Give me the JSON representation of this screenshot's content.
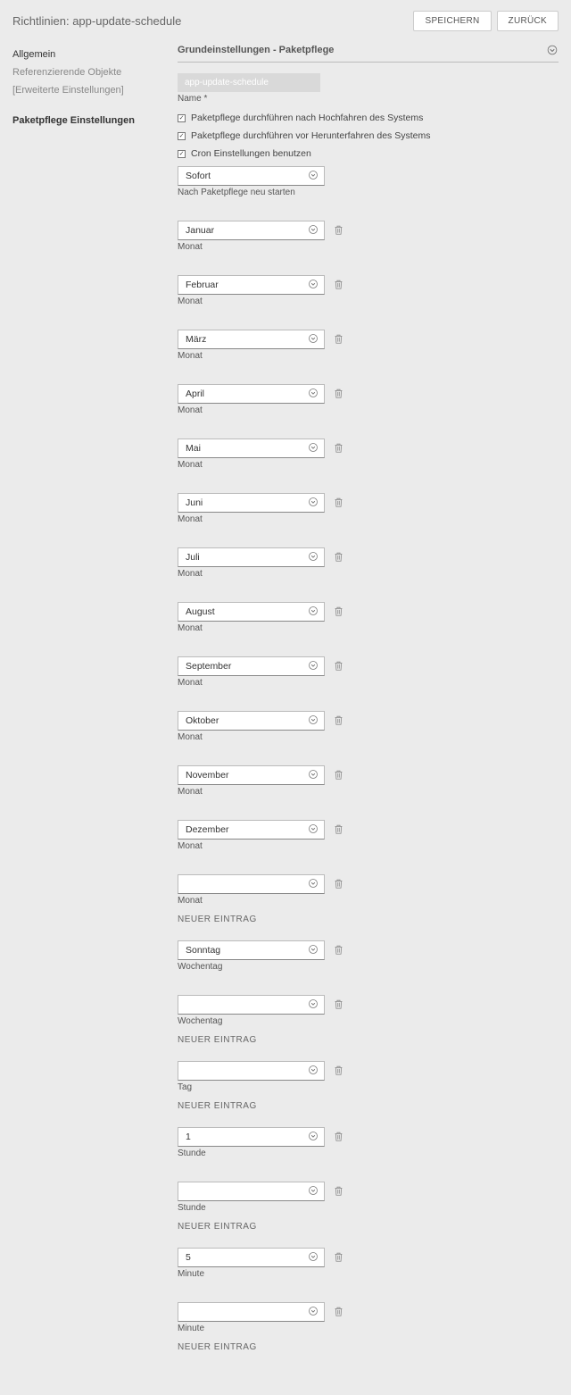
{
  "header": {
    "title": "Richtlinien: app-update-schedule",
    "save": "SPEICHERN",
    "back": "ZURÜCK"
  },
  "sidebar": {
    "items": [
      {
        "label": "Allgemein",
        "active": true
      },
      {
        "label": "Referenzierende Objekte",
        "active": false
      },
      {
        "label": "[Erweiterte Einstellungen]",
        "active": false
      }
    ],
    "heading": "Paketpflege Einstellungen"
  },
  "section": {
    "title": "Grundeinstellungen - Paketpflege",
    "namePlaceholder": "app-update-schedule",
    "nameLabel": "Name *",
    "checkboxes": [
      {
        "label": "Paketpflege durchführen nach Hochfahren des Systems",
        "checked": true
      },
      {
        "label": "Paketpflege durchführen vor Herunterfahren des Systems",
        "checked": true
      },
      {
        "label": "Cron Einstellungen benutzen",
        "checked": true
      }
    ],
    "restart": {
      "value": "Sofort",
      "label": "Nach Paketpflege neu starten"
    },
    "monthLabel": "Monat",
    "months": [
      "Januar",
      "Februar",
      "März",
      "April",
      "Mai",
      "Juni",
      "Juli",
      "August",
      "September",
      "Oktober",
      "November",
      "Dezember",
      ""
    ],
    "weekdayLabel": "Wochentag",
    "weekdays": [
      "Sonntag",
      ""
    ],
    "dayLabel": "Tag",
    "days": [
      ""
    ],
    "hourLabel": "Stunde",
    "hours": [
      "1",
      ""
    ],
    "minuteLabel": "Minute",
    "minutes": [
      "5",
      ""
    ],
    "newEntry": "NEUER EINTRAG"
  }
}
